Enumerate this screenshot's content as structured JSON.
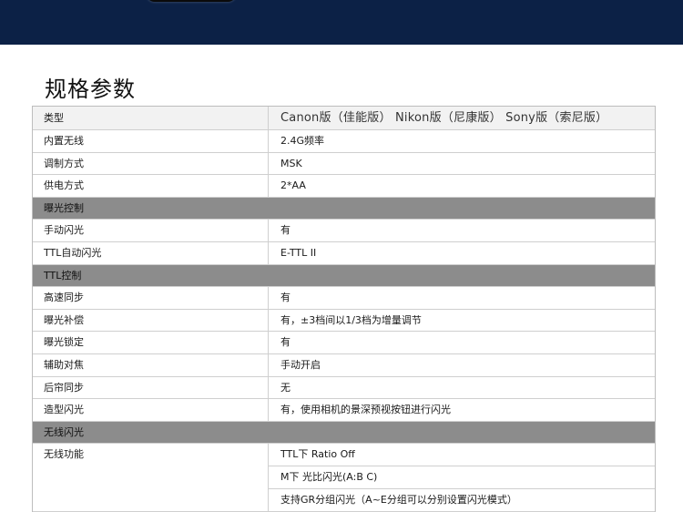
{
  "page": {
    "title": "规格参数"
  },
  "table": {
    "header": {
      "key": "类型",
      "value": "Canon版（佳能版）   Nikon版（尼康版）   Sony版（索尼版）"
    },
    "rows": [
      {
        "key": "内置无线",
        "value": "2.4G频率"
      },
      {
        "key": "调制方式",
        "value": "MSK"
      },
      {
        "key": "供电方式",
        "value": "2*AA"
      },
      {
        "section": "曝光控制"
      },
      {
        "key": "手动闪光",
        "value": "有"
      },
      {
        "key": "TTL自动闪光",
        "value": "E-TTL II"
      },
      {
        "section": "TTL控制"
      },
      {
        "key": "高速同步",
        "value": "有"
      },
      {
        "key": "曝光补偿",
        "value": "有，±3档间以1/3档为增量调节"
      },
      {
        "key": "曝光锁定",
        "value": "有"
      },
      {
        "key": "辅助对焦",
        "value": "手动开启"
      },
      {
        "key": "后帘同步",
        "value": "无"
      },
      {
        "key": "造型闪光",
        "value": "有，使用相机的景深预视按钮进行闪光"
      },
      {
        "section": "无线闪光"
      }
    ],
    "wireless": {
      "key": "无线功能",
      "values": [
        "TTL下 Ratio Off",
        "M下 光比闪光(A:B C)",
        "支持GR分组闪光（A~E分组可以分别设置闪光模式）"
      ]
    }
  },
  "colors": {
    "banner": "#0c2146",
    "section_bg": "#8c8c8c",
    "header_bg": "#f2f2f2"
  }
}
